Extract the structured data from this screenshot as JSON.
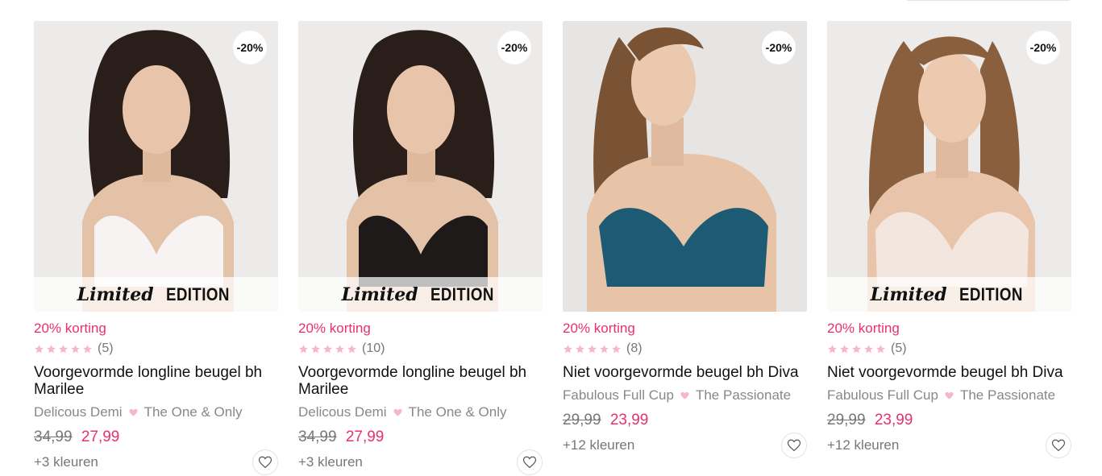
{
  "colors": {
    "accent": "#e8306f",
    "star": "#f5b8c8"
  },
  "products": [
    {
      "badge": "-20%",
      "limited": {
        "script": "Limited",
        "caps": "EDITION"
      },
      "discount": "20% korting",
      "rating_count": "(5)",
      "stars": 5,
      "name": "Voorgevormde longline beugel bh Marilee",
      "line": "Delicous Demi",
      "collection": "The One & Only",
      "old_price": "34,99",
      "price": "27,99",
      "more_colors": "+3 kleuren",
      "bra_color": "white"
    },
    {
      "badge": "-20%",
      "limited": {
        "script": "Limited",
        "caps": "EDITION"
      },
      "discount": "20% korting",
      "rating_count": "(10)",
      "stars": 5,
      "name": "Voorgevormde longline beugel bh Marilee",
      "line": "Delicous Demi",
      "collection": "The One & Only",
      "old_price": "34,99",
      "price": "27,99",
      "more_colors": "+3 kleuren",
      "bra_color": "black"
    },
    {
      "badge": "-20%",
      "discount": "20% korting",
      "rating_count": "(8)",
      "stars": 5,
      "name": "Niet voorgevormde beugel bh Diva",
      "line": "Fabulous Full Cup",
      "collection": "The Passionate",
      "old_price": "29,99",
      "price": "23,99",
      "more_colors": "+12 kleuren",
      "bra_color": "teal"
    },
    {
      "badge": "-20%",
      "limited": {
        "script": "Limited",
        "caps": "EDITION"
      },
      "discount": "20% korting",
      "rating_count": "(5)",
      "stars": 5,
      "name": "Niet voorgevormde beugel bh Diva",
      "line": "Fabulous Full Cup",
      "collection": "The Passionate",
      "old_price": "29,99",
      "price": "23,99",
      "more_colors": "+12 kleuren",
      "bra_color": "blush"
    }
  ]
}
